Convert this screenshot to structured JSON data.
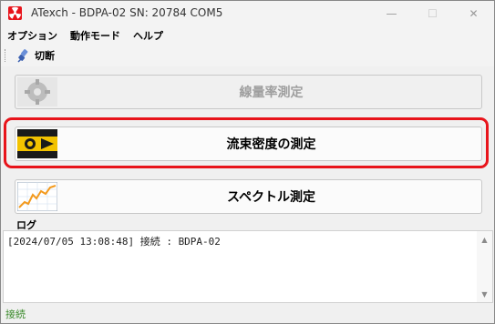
{
  "window": {
    "title": "ATexch - BDPA-02 SN: 20784 COM5",
    "minimize_glyph": "—",
    "maximize_glyph": "☐",
    "close_glyph": "✕"
  },
  "menu": {
    "items": [
      {
        "label": "オプション"
      },
      {
        "label": "動作モード"
      },
      {
        "label": "ヘルプ"
      }
    ]
  },
  "toolbar": {
    "disconnect_label": "切断",
    "disconnect_icon": "plug-icon"
  },
  "buttons": {
    "dose_rate": {
      "label": "線量率測定",
      "enabled": false,
      "icon": "gear-icon"
    },
    "flux_density": {
      "label": "流束密度の測定",
      "enabled": true,
      "highlighted": true,
      "icon": "detector-icon"
    },
    "spectrum": {
      "label": "スペクトル測定",
      "enabled": true,
      "icon": "chart-icon"
    }
  },
  "log": {
    "label": "ログ",
    "lines": [
      "[2024/07/05 13:08:48] 接続 : BDPA-02"
    ]
  },
  "status": {
    "text": "接続",
    "color": "#3a8a2a"
  },
  "colors": {
    "highlight": "#e8141b",
    "app_icon": "#e8141b"
  }
}
